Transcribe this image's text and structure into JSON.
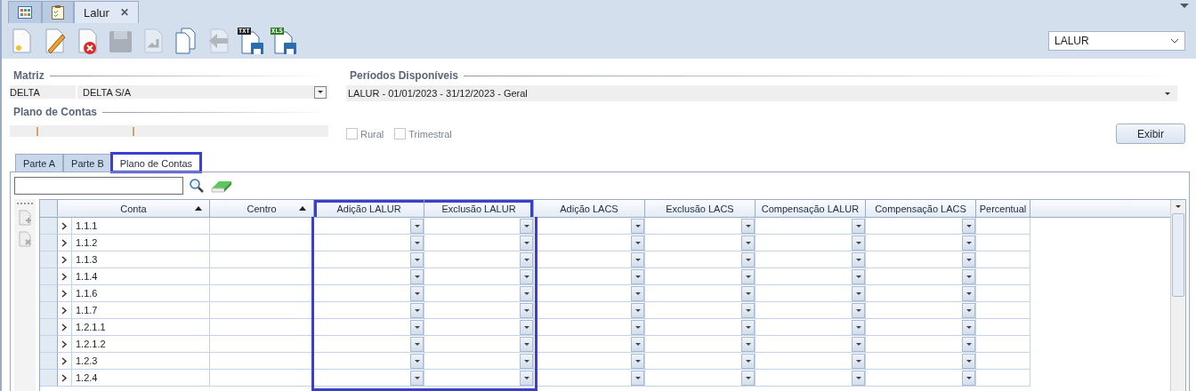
{
  "doc_tabs": [
    {
      "kind": "grid",
      "selected": false
    },
    {
      "kind": "checklist",
      "selected": false
    },
    {
      "kind": "text",
      "label": "Lalur",
      "close": "✕",
      "selected": true
    }
  ],
  "toolbar": [
    {
      "kind": "new",
      "disabled": false
    },
    {
      "kind": "edit",
      "disabled": false
    },
    {
      "kind": "delete",
      "disabled": false
    },
    {
      "kind": "save",
      "disabled": true
    },
    {
      "kind": "undo",
      "disabled": true
    },
    {
      "kind": "copy",
      "disabled": false
    },
    {
      "kind": "back",
      "disabled": true
    },
    {
      "kind": "export",
      "badge": "TXT",
      "color": "#222222",
      "disabled": false
    },
    {
      "kind": "export",
      "badge": "XLS",
      "color": "#2e7d22",
      "disabled": false
    }
  ],
  "module_select": {
    "value": "LALUR"
  },
  "matriz": {
    "title": "Matriz",
    "code": "DELTA",
    "name": "DELTA S/A"
  },
  "plano": {
    "title": "Plano de Contas"
  },
  "periodos": {
    "title": "Períodos Disponíveis",
    "value": "LALUR - 01/01/2023 - 31/12/2023 - Geral"
  },
  "options": [
    {
      "label": "Rural",
      "checked": false
    },
    {
      "label": "Trimestral",
      "checked": false
    }
  ],
  "exibir_button": "Exibir",
  "tabs": [
    {
      "label": "Parte A",
      "selected": false,
      "highlighted": false
    },
    {
      "label": "Parte B",
      "selected": false,
      "highlighted": false
    },
    {
      "label": "Plano de Contas",
      "selected": true,
      "highlighted": true
    }
  ],
  "table": {
    "columns": [
      {
        "label": "Conta",
        "kind": "tree",
        "sorted": true,
        "highlighted": false
      },
      {
        "label": "Centro",
        "kind": "text",
        "sorted": true,
        "highlighted": false
      },
      {
        "label": "Adição LALUR",
        "kind": "combo",
        "sorted": false,
        "highlighted": true
      },
      {
        "label": "Exclusão LALUR",
        "kind": "combo",
        "sorted": false,
        "highlighted": true
      },
      {
        "label": "Adição LACS",
        "kind": "combo",
        "sorted": false,
        "highlighted": false
      },
      {
        "label": "Exclusão LACS",
        "kind": "combo",
        "sorted": false,
        "highlighted": false
      },
      {
        "label": "Compensação LALUR",
        "kind": "combo",
        "sorted": false,
        "highlighted": false
      },
      {
        "label": "Compensação LACS",
        "kind": "combo",
        "sorted": false,
        "highlighted": false
      },
      {
        "label": "Percentual",
        "kind": "text",
        "sorted": false,
        "highlighted": false
      }
    ],
    "rows": [
      {
        "conta": "1.1.1"
      },
      {
        "conta": "1.1.2"
      },
      {
        "conta": "1.1.3"
      },
      {
        "conta": "1.1.4"
      },
      {
        "conta": "1.1.6"
      },
      {
        "conta": "1.1.7"
      },
      {
        "conta": "1.2.1.1"
      },
      {
        "conta": "1.2.1.2"
      },
      {
        "conta": "1.2.3"
      },
      {
        "conta": "1.2.4"
      }
    ]
  }
}
